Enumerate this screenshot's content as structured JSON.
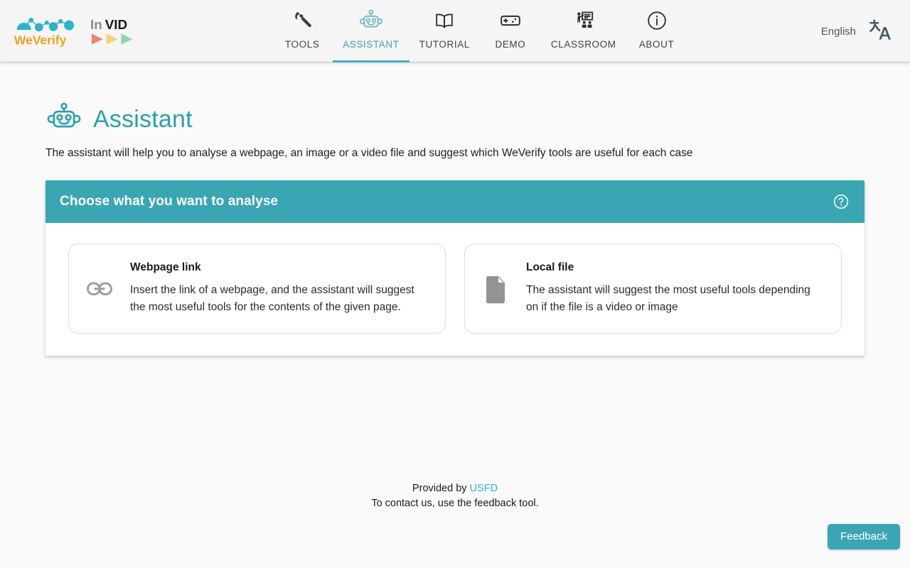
{
  "brand": {
    "weverify_we": "We",
    "weverify_verify": "Verify",
    "invid_in": "In",
    "invid_vid": "VID",
    "weverify_color": "#f5a01a",
    "weverify_graph_color": "#2bb3cc",
    "invid_triangle_colors": [
      "#ea8379",
      "#f2d471",
      "#8fd6a8"
    ]
  },
  "nav": {
    "items": [
      {
        "label": "TOOLS",
        "icon": "wrench-icon",
        "active": false
      },
      {
        "label": "ASSISTANT",
        "icon": "robot-icon",
        "active": true
      },
      {
        "label": "TUTORIAL",
        "icon": "book-icon",
        "active": false
      },
      {
        "label": "DEMO",
        "icon": "gamepad-icon",
        "active": false
      },
      {
        "label": "CLASSROOM",
        "icon": "classroom-icon",
        "active": false
      },
      {
        "label": "ABOUT",
        "icon": "info-circle-icon",
        "active": false
      }
    ],
    "active_color": "#39a3b1",
    "inactive_color": "#424242"
  },
  "language": {
    "label": "English",
    "icon": "translate-icon"
  },
  "hero": {
    "icon": "robot-head-icon",
    "title": "Assistant",
    "title_color": "#2aa1af",
    "subtitle": "The assistant will help you to analyse a webpage, an image or a video file and suggest which WeVerify tools are useful for each case"
  },
  "panel": {
    "header_title": "Choose what you want to analyse",
    "header_color": "#3aa6b3",
    "help_icon": "help-circle-icon",
    "options": [
      {
        "title": "Webpage link",
        "description": "Insert the link of a webpage, and the assistant will suggest the most useful tools for the contents of the given page.",
        "icon": "link-icon"
      },
      {
        "title": "Local file",
        "description": "The assistant will suggest the most useful tools depending on if the file is a video or image",
        "icon": "file-icon"
      }
    ]
  },
  "footer": {
    "provided_by_prefix": "Provided by ",
    "provider_link": "USFD",
    "contact_line": "To contact us, use the feedback tool.",
    "link_color": "#29b6d8"
  },
  "feedback": {
    "label": "Feedback",
    "color": "#3aa6b3"
  }
}
